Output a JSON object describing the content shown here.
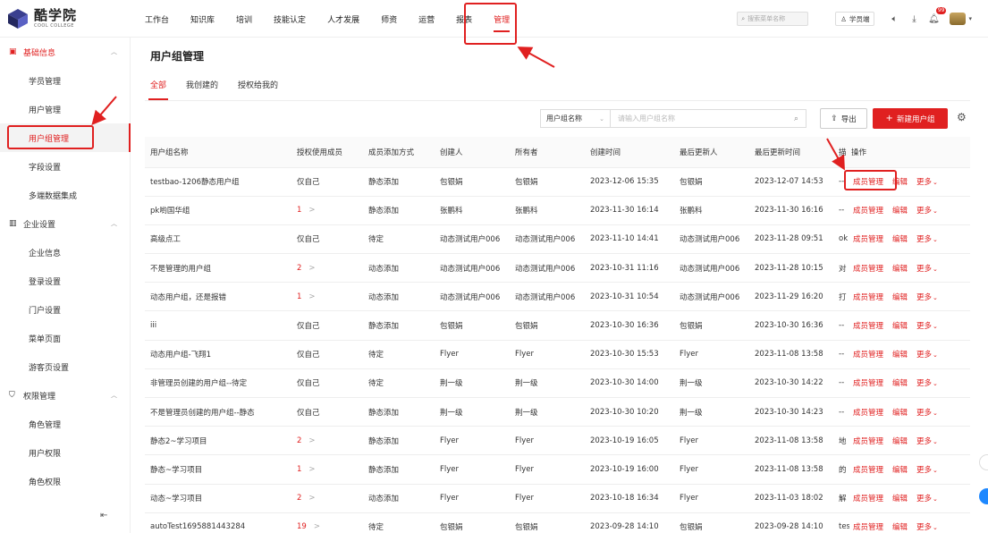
{
  "brand": {
    "title": "酷学院",
    "subtitle": "COOL COLLEGE"
  },
  "nav": [
    "工作台",
    "知识库",
    "培训",
    "技能认定",
    "人才发展",
    "师资",
    "运营",
    "报表",
    "管理"
  ],
  "top": {
    "search_placeholder": "搜索菜单名称",
    "student_btn": "学员端",
    "bell_badge": "99"
  },
  "sidebar": {
    "groups": [
      {
        "label": "基础信息",
        "items": [
          "学员管理",
          "用户管理",
          "用户组管理",
          "字段设置",
          "多端数据集成"
        ]
      },
      {
        "label": "企业设置",
        "items": [
          "企业信息",
          "登录设置",
          "门户设置",
          "菜单页面",
          "游客页设置"
        ]
      },
      {
        "label": "权限管理",
        "items": [
          "角色管理",
          "用户权限",
          "角色权限"
        ]
      }
    ]
  },
  "page": {
    "title": "用户组管理",
    "tabs": [
      "全部",
      "我创建的",
      "授权给我的"
    ],
    "filter_select": "用户组名称",
    "filter_placeholder": "请输入用户组名称",
    "export_label": "导出",
    "new_label": "新建用户组"
  },
  "table": {
    "headers": [
      "用户组名称",
      "授权使用成员",
      "成员添加方式",
      "创建人",
      "所有者",
      "创建时间",
      "最后更新人",
      "最后更新时间",
      "描",
      "操作"
    ],
    "op_labels": {
      "members": "成员管理",
      "edit": "编辑",
      "more": "更多"
    },
    "rows": [
      {
        "name": "testbao-1206静态用户组",
        "auth": "仅自己",
        "auth_count": false,
        "method": "静态添加",
        "creator": "包银娟",
        "owner": "包银娟",
        "created": "2023-12-06 15:35",
        "updater": "包银娟",
        "updated": "2023-12-07 14:53",
        "desc": "--"
      },
      {
        "name": "pk哟国华组",
        "auth": "1",
        "auth_count": true,
        "method": "静态添加",
        "creator": "张鹏科",
        "owner": "张鹏科",
        "created": "2023-11-30 16:14",
        "updater": "张鹏科",
        "updated": "2023-11-30 16:16",
        "desc": "--"
      },
      {
        "name": "高级点工",
        "auth": "仅自己",
        "auth_count": false,
        "method": "待定",
        "creator": "动态测试用户006",
        "owner": "动态测试用户006",
        "created": "2023-11-10 14:41",
        "updater": "动态测试用户006",
        "updated": "2023-11-28 09:51",
        "desc": "ok"
      },
      {
        "name": "不是管理的用户组",
        "auth": "2",
        "auth_count": true,
        "method": "动态添加",
        "creator": "动态测试用户006",
        "owner": "动态测试用户006",
        "created": "2023-10-31 11:16",
        "updater": "动态测试用户006",
        "updated": "2023-11-28 10:15",
        "desc": "对"
      },
      {
        "name": "动态用户组，还是报错",
        "auth": "1",
        "auth_count": true,
        "method": "动态添加",
        "creator": "动态测试用户006",
        "owner": "动态测试用户006",
        "created": "2023-10-31 10:54",
        "updater": "动态测试用户006",
        "updated": "2023-11-29 16:20",
        "desc": "打"
      },
      {
        "name": "iii",
        "auth": "仅自己",
        "auth_count": false,
        "method": "静态添加",
        "creator": "包银娟",
        "owner": "包银娟",
        "created": "2023-10-30 16:36",
        "updater": "包银娟",
        "updated": "2023-10-30 16:36",
        "desc": "--"
      },
      {
        "name": "动态用户组-飞翔1",
        "auth": "仅自己",
        "auth_count": false,
        "method": "待定",
        "creator": "Flyer",
        "owner": "Flyer",
        "created": "2023-10-30 15:53",
        "updater": "Flyer",
        "updated": "2023-11-08 13:58",
        "desc": "--"
      },
      {
        "name": "非管理员创建的用户组--待定",
        "auth": "仅自己",
        "auth_count": false,
        "method": "待定",
        "creator": "荆一级",
        "owner": "荆一级",
        "created": "2023-10-30 14:00",
        "updater": "荆一级",
        "updated": "2023-10-30 14:22",
        "desc": "--"
      },
      {
        "name": "不是管理员创建的用户组--静态",
        "auth": "仅自己",
        "auth_count": false,
        "method": "静态添加",
        "creator": "荆一级",
        "owner": "荆一级",
        "created": "2023-10-30 10:20",
        "updater": "荆一级",
        "updated": "2023-10-30 14:23",
        "desc": "--"
      },
      {
        "name": "静态2~学习项目",
        "auth": "2",
        "auth_count": true,
        "method": "静态添加",
        "creator": "Flyer",
        "owner": "Flyer",
        "created": "2023-10-19 16:05",
        "updater": "Flyer",
        "updated": "2023-11-08 13:58",
        "desc": "地"
      },
      {
        "name": "静态~学习项目",
        "auth": "1",
        "auth_count": true,
        "method": "静态添加",
        "creator": "Flyer",
        "owner": "Flyer",
        "created": "2023-10-19 16:00",
        "updater": "Flyer",
        "updated": "2023-11-08 13:58",
        "desc": "的"
      },
      {
        "name": "动态~学习项目",
        "auth": "2",
        "auth_count": true,
        "method": "动态添加",
        "creator": "Flyer",
        "owner": "Flyer",
        "created": "2023-10-18 16:34",
        "updater": "Flyer",
        "updated": "2023-11-03 18:02",
        "desc": "解"
      },
      {
        "name": "autoTest1695881443284",
        "auth": "19",
        "auth_count": true,
        "method": "待定",
        "creator": "包银娟",
        "owner": "包银娟",
        "created": "2023-09-28 14:10",
        "updater": "包银娟",
        "updated": "2023-09-28 14:10",
        "desc": "tes"
      }
    ]
  },
  "colors": {
    "accent": "#e02020",
    "border": "#eeeeee",
    "header_bg": "#fafafa"
  }
}
